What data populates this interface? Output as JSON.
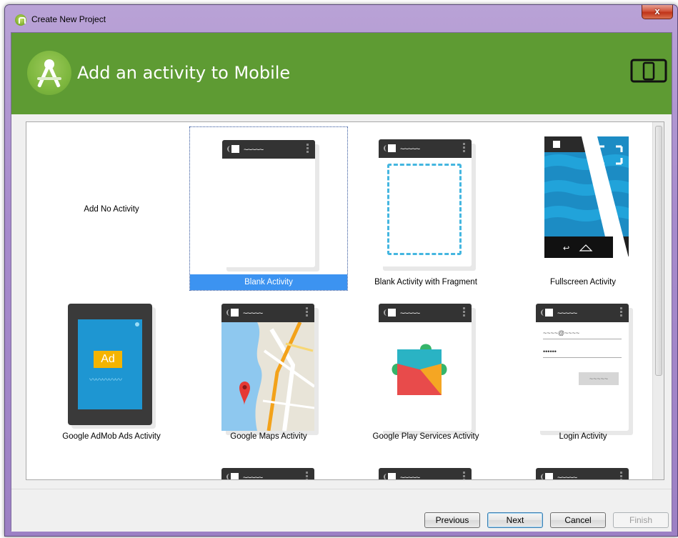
{
  "window": {
    "title": "Create New Project",
    "close_label": "x"
  },
  "banner": {
    "title": "Add an activity to Mobile"
  },
  "templates": [
    {
      "label": "Add No Activity"
    },
    {
      "label": "Blank Activity"
    },
    {
      "label": "Blank Activity with Fragment"
    },
    {
      "label": "Fullscreen Activity"
    },
    {
      "label": "Google AdMob Ads Activity"
    },
    {
      "label": "Google Maps Activity"
    },
    {
      "label": "Google Play Services Activity"
    },
    {
      "label": "Login Activity"
    }
  ],
  "admob": {
    "badge": "Ad"
  },
  "login": {
    "email_placeholder": "~~~~@~~~~",
    "password_placeholder": "••••••",
    "button_label": "~~~~~"
  },
  "buttons": {
    "previous": "Previous",
    "next": "Next",
    "cancel": "Cancel",
    "finish": "Finish"
  },
  "status_wave": "~~~~~",
  "colors": {
    "banner": "#5e9b33",
    "selection": "#3c93f1",
    "fragment_dash": "#44b6e0"
  }
}
